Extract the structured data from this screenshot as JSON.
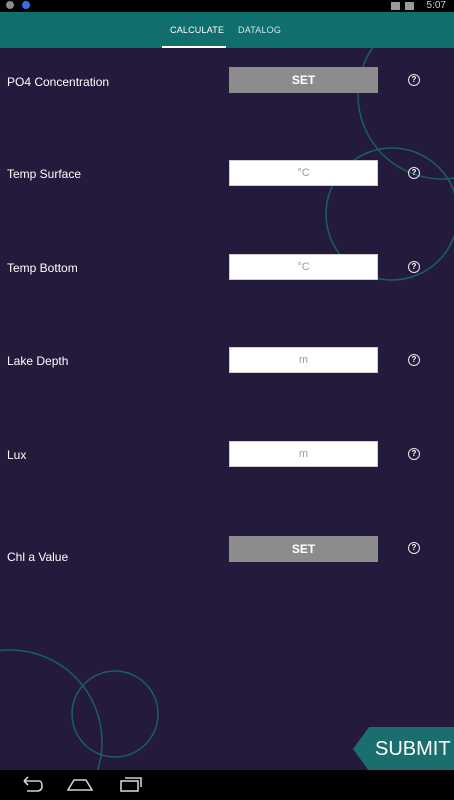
{
  "status_bar": {
    "time": "5:07"
  },
  "tabs": [
    {
      "label": "CALCULATE",
      "active": true
    },
    {
      "label": "DATALOG",
      "active": false
    }
  ],
  "form": {
    "rows": [
      {
        "label": "PO4 Concentration",
        "control": "button",
        "button_label": "SET"
      },
      {
        "label": "Temp Surface",
        "control": "input",
        "value": "",
        "placeholder": "°C"
      },
      {
        "label": "Temp Bottom",
        "control": "input",
        "value": "",
        "placeholder": "°C"
      },
      {
        "label": "Lake Depth",
        "control": "input",
        "value": "",
        "placeholder": "m"
      },
      {
        "label": "Lux",
        "control": "input",
        "value": "",
        "placeholder": "m"
      },
      {
        "label": "Chl a Value",
        "control": "button",
        "button_label": "SET"
      }
    ],
    "help_glyph": "?"
  },
  "submit_label": "SUBMIT",
  "colors": {
    "app_bar": "#106e6d",
    "background": "#241a3c",
    "accent": "#1a6f6e",
    "set_button": "#8c8c8c"
  },
  "icons": {
    "help": "help-circle-icon",
    "back": "back-icon",
    "home": "home-icon",
    "recents": "recent-apps-icon"
  }
}
